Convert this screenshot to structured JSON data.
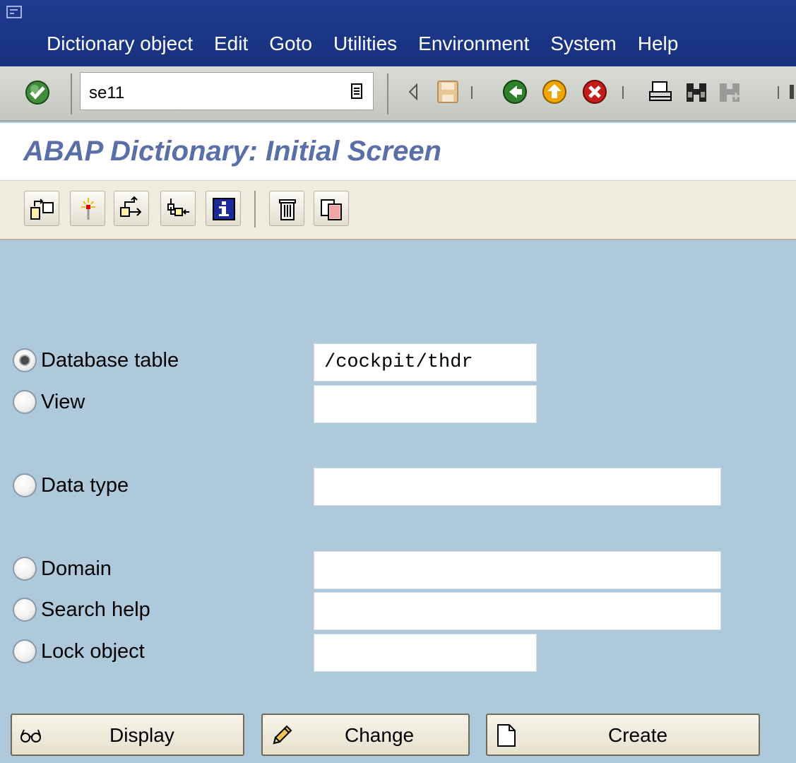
{
  "menubar": {
    "items": [
      {
        "label": "Dictionary object"
      },
      {
        "label": "Edit"
      },
      {
        "label": "Goto"
      },
      {
        "label": "Utilities"
      },
      {
        "label": "Environment"
      },
      {
        "label": "System"
      },
      {
        "label": "Help"
      }
    ]
  },
  "toolbar": {
    "command_value": "se11"
  },
  "title": "ABAP Dictionary: Initial Screen",
  "form": {
    "options": [
      {
        "label": "Database table",
        "value": "/cockpit/thdr",
        "selected": true
      },
      {
        "label": "View",
        "value": "",
        "selected": false
      },
      {
        "label": "Data type",
        "value": "",
        "selected": false
      },
      {
        "label": "Domain",
        "value": "",
        "selected": false
      },
      {
        "label": "Search help",
        "value": "",
        "selected": false
      },
      {
        "label": "Lock object",
        "value": "",
        "selected": false
      }
    ]
  },
  "actions": {
    "display": "Display",
    "change": "Change",
    "create": "Create"
  },
  "colors": {
    "menubar": "#1f3a8e",
    "title_text": "#5a6fa8",
    "background": "#aec9dc",
    "app_toolbar": "#efebdf"
  }
}
